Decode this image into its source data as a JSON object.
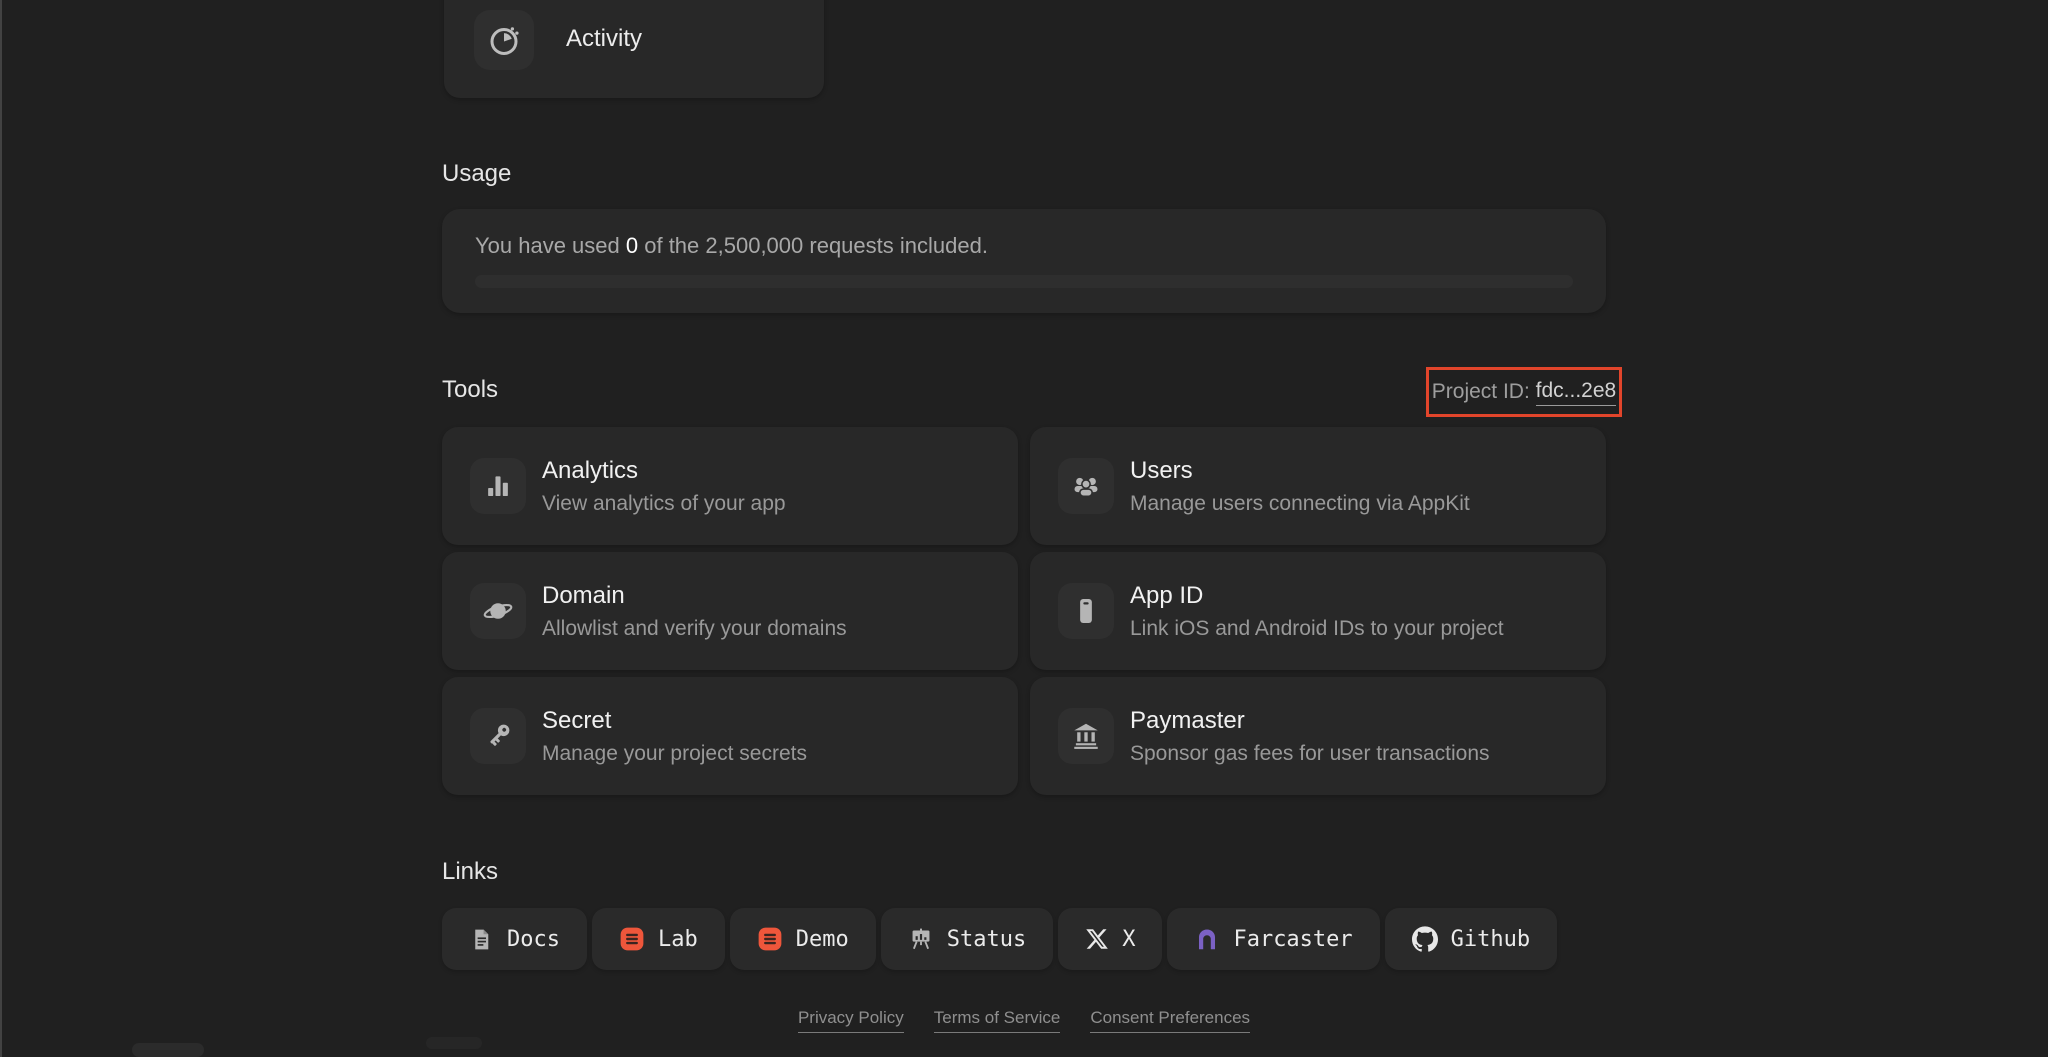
{
  "page": {
    "background": "#202020",
    "card_background": "#282828"
  },
  "activity_card": {
    "label": "Activity",
    "icon": "clock-activity-icon"
  },
  "usage": {
    "heading": "Usage",
    "text_prefix": "You have used ",
    "used_value": "0",
    "text_suffix": " of the 2,500,000 requests included.",
    "progress_percent": 0
  },
  "tools": {
    "heading": "Tools",
    "project_id": {
      "label": "Project ID: ",
      "value": "fdc...2e8",
      "highlight_color": "#e2452b"
    },
    "cards": [
      {
        "title": "Analytics",
        "description": "View analytics of your app",
        "icon": "bar-chart-icon"
      },
      {
        "title": "Users",
        "description": "Manage users connecting via AppKit",
        "icon": "users-icon"
      },
      {
        "title": "Domain",
        "description": "Allowlist and verify your domains",
        "icon": "planet-icon"
      },
      {
        "title": "App ID",
        "description": "Link iOS and Android IDs to your project",
        "icon": "mobile-phone-icon"
      },
      {
        "title": "Secret",
        "description": "Manage your project secrets",
        "icon": "key-icon"
      },
      {
        "title": "Paymaster",
        "description": "Sponsor gas fees for user transactions",
        "icon": "bank-icon"
      }
    ]
  },
  "links": {
    "heading": "Links",
    "items": [
      {
        "label": "Docs",
        "icon": "document-icon",
        "icon_color": "#b5b5b5"
      },
      {
        "label": "Lab",
        "icon": "lab-terminal-icon",
        "icon_color": "#ee563b"
      },
      {
        "label": "Demo",
        "icon": "demo-terminal-icon",
        "icon_color": "#ee563b"
      },
      {
        "label": "Status",
        "icon": "status-easel-icon",
        "icon_color": "#b5b5b5"
      },
      {
        "label": "X",
        "icon": "x-logo-icon",
        "icon_color": "#e8e8e8"
      },
      {
        "label": "Farcaster",
        "icon": "farcaster-arch-icon",
        "icon_color": "#7b61c4"
      },
      {
        "label": "Github",
        "icon": "github-icon",
        "icon_color": "#e8e8e8"
      }
    ]
  },
  "footer": {
    "privacy": "Privacy Policy",
    "terms": "Terms of Service",
    "consent": "Consent Preferences"
  }
}
